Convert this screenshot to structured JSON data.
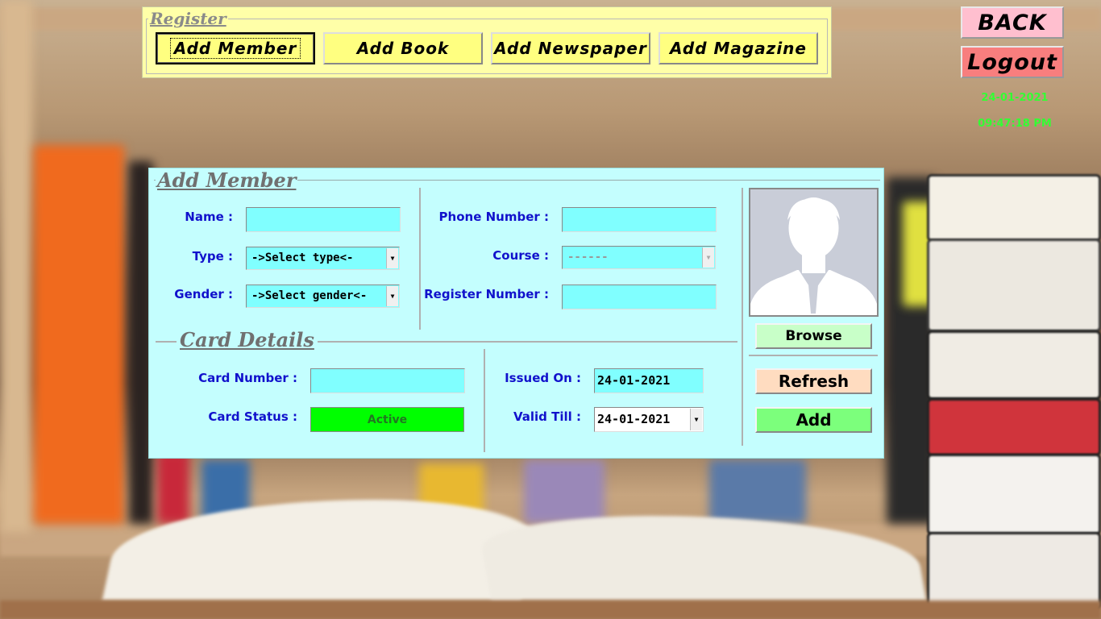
{
  "register": {
    "legend": "Register",
    "buttons": [
      {
        "label": "Add Member",
        "active": true
      },
      {
        "label": "Add Book",
        "active": false
      },
      {
        "label": "Add Newspaper",
        "active": false
      },
      {
        "label": "Add Magazine",
        "active": false
      }
    ]
  },
  "top": {
    "back_label": "BACK",
    "logout_label": "Logout",
    "date": "24-01-2021",
    "time": "09:47:18 PM"
  },
  "add_member": {
    "title": "Add Member",
    "name_label": "Name :",
    "name_value": "",
    "type_label": "Type :",
    "type_value": "->Select type<-",
    "gender_label": "Gender :",
    "gender_value": "->Select gender<-",
    "phone_label": "Phone Number :",
    "phone_value": "",
    "course_label": "Course :",
    "course_value": "------",
    "register_label": "Register Number :",
    "register_value": ""
  },
  "card": {
    "title": "Card Details",
    "number_label": "Card Number :",
    "number_value": "",
    "status_label": "Card Status :",
    "status_value": "Active",
    "issued_label": "Issued On :",
    "issued_value": "24-01-2021",
    "valid_label": "Valid Till :",
    "valid_value": "24-01-2021"
  },
  "actions": {
    "browse_label": "Browse",
    "refresh_label": "Refresh",
    "add_label": "Add"
  },
  "colors": {
    "register_bg": "#ffffa8",
    "register_button": "#ffff80",
    "back_button": "#ffbfcf",
    "logout_button": "#f87e7e",
    "clock_text": "#33ff33",
    "panel_bg": "#c4fefe",
    "input_bg": "#80ffff",
    "label_text": "#1111cc",
    "status_active": "#00ff00",
    "browse_button": "#c8ffc8",
    "refresh_button": "#ffdcc0",
    "add_button": "#7cff7c"
  }
}
